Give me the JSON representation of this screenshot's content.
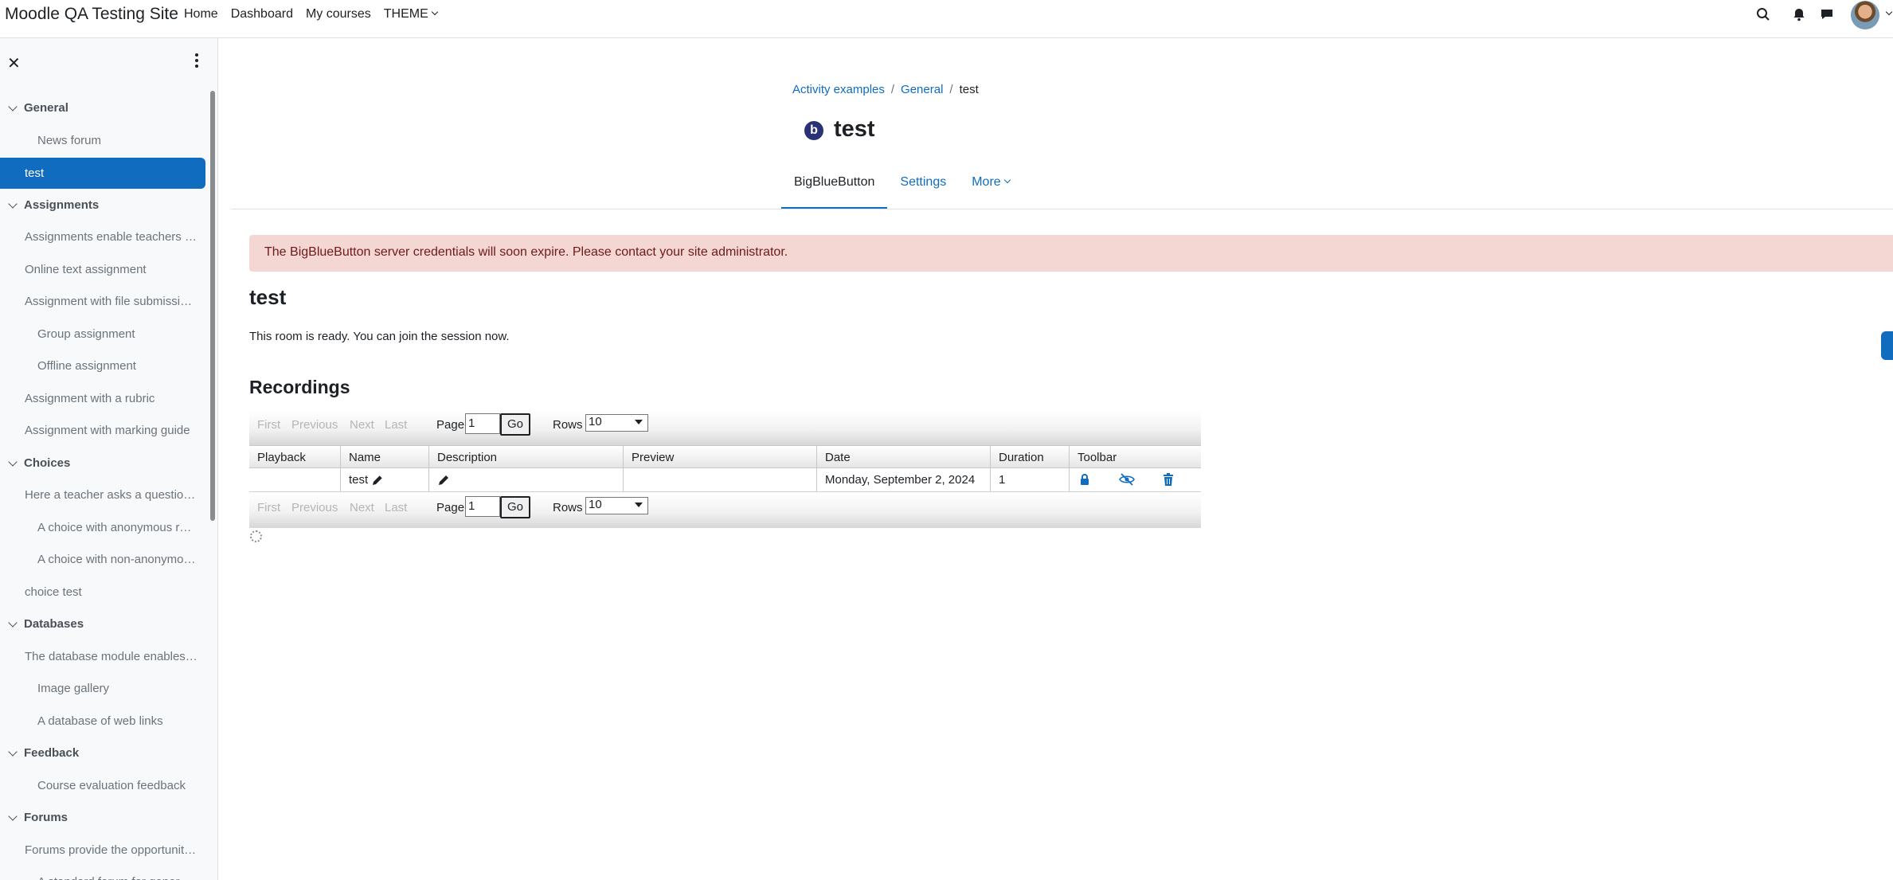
{
  "header": {
    "site_name": "Moodle QA Testing Site",
    "nav": [
      "Home",
      "Dashboard",
      "My courses",
      "THEME"
    ]
  },
  "drawer": {
    "items": [
      {
        "type": "section",
        "label": "General"
      },
      {
        "type": "item",
        "label": "News forum",
        "indent": 2
      },
      {
        "type": "active",
        "label": "test"
      },
      {
        "type": "section",
        "label": "Assignments"
      },
      {
        "type": "item",
        "label": "Assignments enable teachers …",
        "indent": 1
      },
      {
        "type": "item",
        "label": "Online text assignment",
        "indent": 1
      },
      {
        "type": "item",
        "label": "Assignment with file submissi…",
        "indent": 1
      },
      {
        "type": "item",
        "label": "Group assignment",
        "indent": 2
      },
      {
        "type": "item",
        "label": "Offline assignment",
        "indent": 2
      },
      {
        "type": "item",
        "label": "Assignment with a rubric",
        "indent": 1
      },
      {
        "type": "item",
        "label": "Assignment with marking guide",
        "indent": 1
      },
      {
        "type": "section",
        "label": "Choices"
      },
      {
        "type": "item",
        "label": "Here a teacher asks a questio…",
        "indent": 1
      },
      {
        "type": "item",
        "label": "A choice with anonymous r…",
        "indent": 2
      },
      {
        "type": "item",
        "label": "A choice with non-anonymo…",
        "indent": 2
      },
      {
        "type": "item",
        "label": "choice test",
        "indent": 1
      },
      {
        "type": "section",
        "label": "Databases"
      },
      {
        "type": "item",
        "label": "The database module enables…",
        "indent": 1
      },
      {
        "type": "item",
        "label": "Image gallery",
        "indent": 2
      },
      {
        "type": "item",
        "label": "A database of web links",
        "indent": 2
      },
      {
        "type": "section",
        "label": "Feedback"
      },
      {
        "type": "item",
        "label": "Course evaluation feedback",
        "indent": 2
      },
      {
        "type": "section",
        "label": "Forums"
      },
      {
        "type": "item",
        "label": "Forums provide the opportunit…",
        "indent": 1
      },
      {
        "type": "item",
        "label": "A standard forum for gener…",
        "indent": 2
      }
    ]
  },
  "breadcrumb": {
    "items": [
      "Activity examples",
      "General"
    ],
    "current": "test"
  },
  "page": {
    "icon_letter": "b",
    "title": "test",
    "tabs": [
      "BigBlueButton",
      "Settings",
      "More"
    ],
    "alert": "The BigBlueButton server credentials will soon expire. Please contact your site administrator.",
    "activity_title": "test",
    "room_status": "This room is ready. You can join the session now."
  },
  "recordings": {
    "heading": "Recordings",
    "pager": {
      "first": "First",
      "previous": "Previous",
      "next": "Next",
      "last": "Last",
      "page_label": "Page",
      "page_value": "1",
      "go": "Go",
      "rows_label": "Rows",
      "rows_value": "10"
    },
    "columns": [
      "Playback",
      "Name",
      "Description",
      "Preview",
      "Date",
      "Duration",
      "Toolbar"
    ],
    "rows": [
      {
        "playback": "",
        "name": "test",
        "description": "",
        "preview": "",
        "date": "Monday, September 2, 2024",
        "duration": "1"
      }
    ]
  }
}
